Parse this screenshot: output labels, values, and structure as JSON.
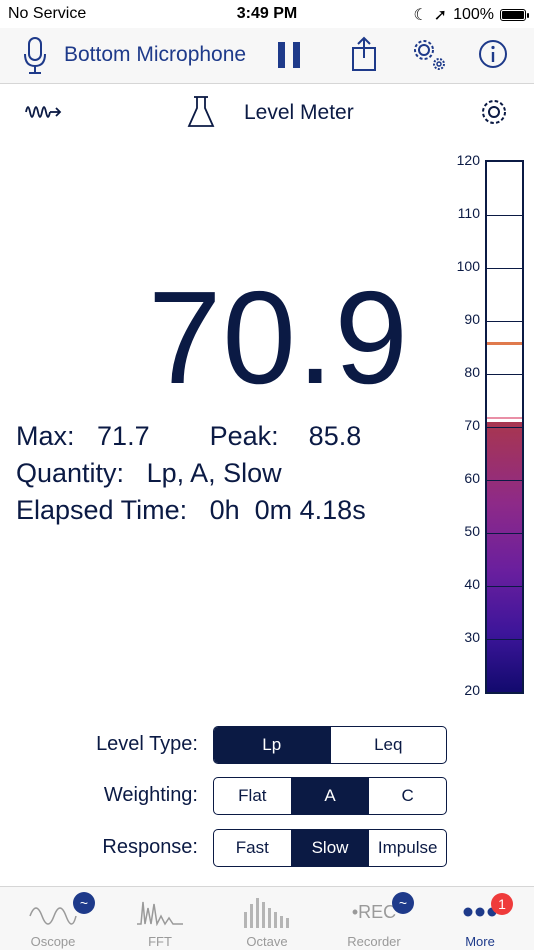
{
  "status_bar": {
    "carrier": "No Service",
    "time": "3:49 PM",
    "battery": "100%"
  },
  "toolbar": {
    "input_name": "Bottom Microphone"
  },
  "subheader": {
    "title": "Level Meter"
  },
  "reading": {
    "value": "70.9",
    "max_label": "Max:",
    "max_value": "71.7",
    "peak_label": "Peak:",
    "peak_value": "85.8",
    "quantity_label": "Quantity:",
    "quantity_value": "Lp, A, Slow",
    "elapsed_label": "Elapsed Time:",
    "elapsed_value": "0h  0m 4.18s"
  },
  "meter": {
    "scale_labels": [
      "120",
      "110",
      "100",
      "90",
      "80",
      "70",
      "60",
      "50",
      "40",
      "30",
      "20"
    ],
    "scale_min": 20,
    "scale_max": 120,
    "level": 70.9,
    "max": 71.7,
    "peak": 85.8,
    "colors": {
      "border": "#0b1a44",
      "fill_top": "#a8364f",
      "fill_bottom": "#120a6e",
      "peak_marker": "#e07a4d",
      "max_marker": "#e98fa6"
    }
  },
  "controls": {
    "level_type": {
      "label": "Level Type:",
      "options": [
        "Lp",
        "Leq"
      ],
      "selected": "Lp"
    },
    "weighting": {
      "label": "Weighting:",
      "options": [
        "Flat",
        "A",
        "C"
      ],
      "selected": "A"
    },
    "response": {
      "label": "Response:",
      "options": [
        "Fast",
        "Slow",
        "Impulse"
      ],
      "selected": "Slow"
    }
  },
  "tabbar": {
    "tabs": [
      {
        "label": "Oscope",
        "icon": "oscope-icon",
        "badge": "~"
      },
      {
        "label": "FFT",
        "icon": "fft-icon"
      },
      {
        "label": "Octave",
        "icon": "octave-icon"
      },
      {
        "label": "Recorder",
        "icon": "recorder-icon",
        "icon_text": "•REC",
        "badge": "~"
      },
      {
        "label": "More",
        "icon": "more-icon",
        "badge": "1"
      }
    ],
    "active": "More"
  },
  "colors": {
    "accent": "#1e3a8a",
    "text": "#0b1a44",
    "inactive_tab": "#9a9a9a",
    "notification": "#ef3b3b"
  }
}
